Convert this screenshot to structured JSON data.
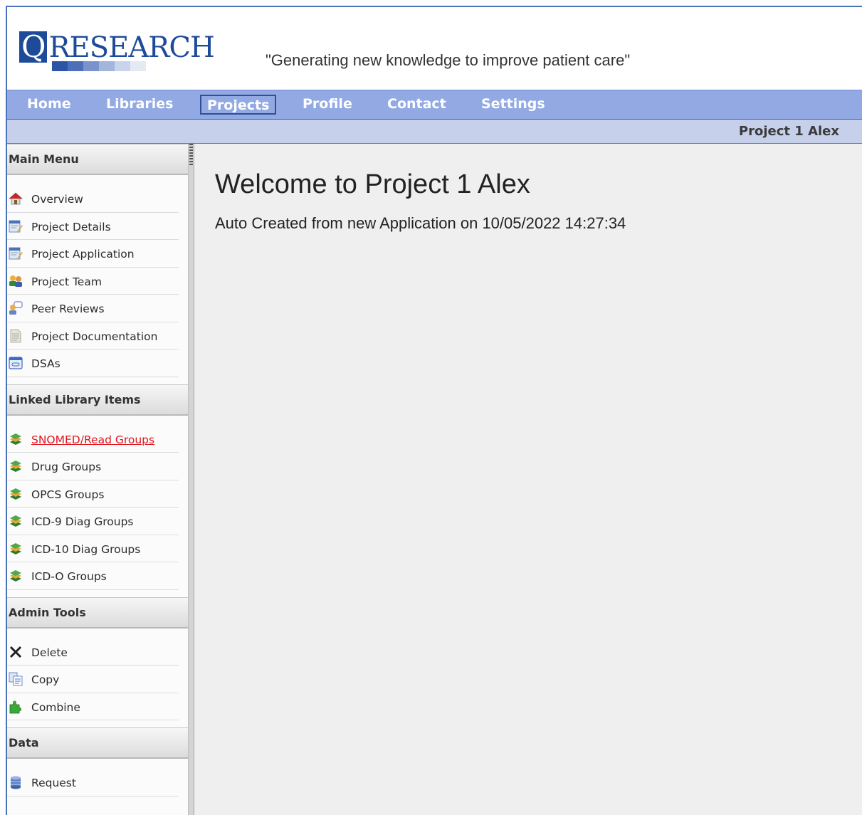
{
  "header": {
    "logo_letter": "Q",
    "logo_rest": "RESEARCH",
    "tagline": "\"Generating new knowledge to improve patient care\"",
    "brand_color": "#1e4a9a"
  },
  "nav": {
    "items": [
      {
        "label": "Home"
      },
      {
        "label": "Libraries"
      },
      {
        "label": "Projects",
        "active": true
      },
      {
        "label": "Profile"
      },
      {
        "label": "Contact"
      },
      {
        "label": "Settings"
      }
    ]
  },
  "breadcrumb": {
    "current": "Project 1 Alex"
  },
  "sidebar": {
    "sections": [
      {
        "title": "Main Menu",
        "items": [
          {
            "label": "Overview",
            "icon": "house-icon"
          },
          {
            "label": "Project Details",
            "icon": "edit-form-icon"
          },
          {
            "label": "Project Application",
            "icon": "edit-form-icon"
          },
          {
            "label": "Project Team",
            "icon": "people-icon"
          },
          {
            "label": "Peer Reviews",
            "icon": "person-chat-icon"
          },
          {
            "label": "Project Documentation",
            "icon": "document-icon"
          },
          {
            "label": "DSAs",
            "icon": "window-icon"
          }
        ]
      },
      {
        "title": "Linked Library Items",
        "items": [
          {
            "label": "SNOMED/Read Groups",
            "icon": "books-icon",
            "selected": true
          },
          {
            "label": "Drug Groups",
            "icon": "books-icon"
          },
          {
            "label": "OPCS Groups",
            "icon": "books-icon"
          },
          {
            "label": "ICD-9 Diag Groups",
            "icon": "books-icon"
          },
          {
            "label": "ICD-10 Diag Groups",
            "icon": "books-icon"
          },
          {
            "label": "ICD-O Groups",
            "icon": "books-icon"
          }
        ]
      },
      {
        "title": "Admin Tools",
        "items": [
          {
            "label": "Delete",
            "icon": "x-icon"
          },
          {
            "label": "Copy",
            "icon": "copy-icon"
          },
          {
            "label": "Combine",
            "icon": "puzzle-icon"
          }
        ]
      },
      {
        "title": "Data",
        "items": [
          {
            "label": "Request",
            "icon": "database-icon"
          }
        ]
      }
    ]
  },
  "main": {
    "title": "Welcome to Project 1 Alex",
    "subtitle": "Auto Created from new Application on 10/05/2022 14:27:34"
  },
  "colors": {
    "nav_bg": "#92a9e3",
    "subbar_bg": "#c7d0ea",
    "content_bg": "#efefef",
    "selected_link": "#e0161e"
  }
}
